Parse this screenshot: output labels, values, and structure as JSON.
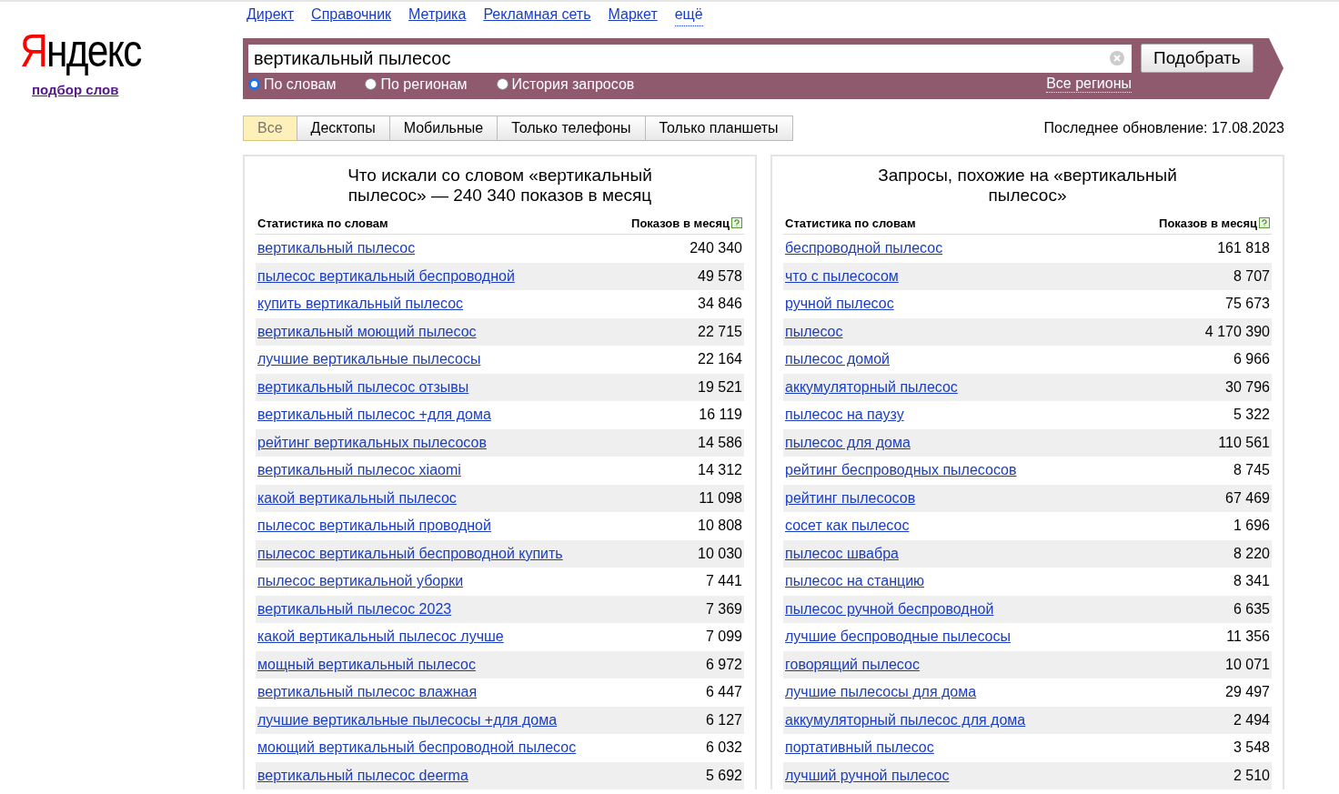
{
  "nav_links": [
    {
      "label": "Директ",
      "kind": "link"
    },
    {
      "label": "Справочник",
      "kind": "link"
    },
    {
      "label": "Метрика",
      "kind": "link"
    },
    {
      "label": "Рекламная сеть",
      "kind": "link"
    },
    {
      "label": "Маркет",
      "kind": "link"
    },
    {
      "label": "ещё",
      "kind": "more"
    }
  ],
  "logo": {
    "initial": "Я",
    "rest": "ндекс",
    "subtitle": "подбор слов"
  },
  "search": {
    "value": "вертикальный пылесос",
    "button": "Подобрать",
    "modes": [
      {
        "label": "По словам",
        "selected": true
      },
      {
        "label": "По регионам",
        "selected": false
      },
      {
        "label": "История запросов",
        "selected": false
      }
    ],
    "region_link": "Все регионы"
  },
  "device_tabs": [
    {
      "label": "Все",
      "selected": true
    },
    {
      "label": "Десктопы",
      "selected": false
    },
    {
      "label": "Мобильные",
      "selected": false
    },
    {
      "label": "Только телефоны",
      "selected": false
    },
    {
      "label": "Только планшеты",
      "selected": false
    }
  ],
  "last_update": "Последнее обновление: 17.08.2023",
  "panels": [
    {
      "title": "Что искали со словом «вертикальный пылесос» — 240 340 показов в месяц",
      "columns": [
        "Статистика по словам",
        "Показов в месяц"
      ],
      "rows": [
        {
          "phrase": "вертикальный пылесос",
          "count": "240 340"
        },
        {
          "phrase": "пылесос вертикальный беспроводной",
          "count": "49 578"
        },
        {
          "phrase": "купить вертикальный пылесос",
          "count": "34 846"
        },
        {
          "phrase": "вертикальный моющий пылесос",
          "count": "22 715"
        },
        {
          "phrase": "лучшие вертикальные пылесосы",
          "count": "22 164"
        },
        {
          "phrase": "вертикальный пылесос отзывы",
          "count": "19 521"
        },
        {
          "phrase": "вертикальный пылесос +для дома",
          "count": "16 119"
        },
        {
          "phrase": "рейтинг вертикальных пылесосов",
          "count": "14 586"
        },
        {
          "phrase": "вертикальный пылесос xiaomi",
          "count": "14 312"
        },
        {
          "phrase": "какой вертикальный пылесос",
          "count": "11 098"
        },
        {
          "phrase": "пылесос вертикальный проводной",
          "count": "10 808"
        },
        {
          "phrase": "пылесос вертикальный беспроводной купить",
          "count": "10 030"
        },
        {
          "phrase": "пылесос вертикальной уборки",
          "count": "7 441"
        },
        {
          "phrase": "вертикальный пылесос 2023",
          "count": "7 369"
        },
        {
          "phrase": "какой вертикальный пылесос лучше",
          "count": "7 099"
        },
        {
          "phrase": "мощный вертикальный пылесос",
          "count": "6 972"
        },
        {
          "phrase": "вертикальный пылесос влажная",
          "count": "6 447"
        },
        {
          "phrase": "лучшие вертикальные пылесосы +для дома",
          "count": "6 127"
        },
        {
          "phrase": "моющий вертикальный беспроводной пылесос",
          "count": "6 032"
        },
        {
          "phrase": "вертикальный пылесос deerma",
          "count": "5 692"
        }
      ]
    },
    {
      "title": "Запросы, похожие на «вертикальный пылесос»",
      "columns": [
        "Статистика по словам",
        "Показов в месяц"
      ],
      "rows": [
        {
          "phrase": "беспроводной пылесос",
          "count": "161 818"
        },
        {
          "phrase": "что с пылесосом",
          "count": "8 707"
        },
        {
          "phrase": "ручной пылесос",
          "count": "75 673"
        },
        {
          "phrase": "пылесос",
          "count": "4 170 390"
        },
        {
          "phrase": "пылесос домой",
          "count": "6 966"
        },
        {
          "phrase": "аккумуляторный пылесос",
          "count": "30 796"
        },
        {
          "phrase": "пылесос на паузу",
          "count": "5 322"
        },
        {
          "phrase": "пылесос для дома",
          "count": "110 561"
        },
        {
          "phrase": "рейтинг беспроводных пылесосов",
          "count": "8 745"
        },
        {
          "phrase": "рейтинг пылесосов",
          "count": "67 469"
        },
        {
          "phrase": "сосет как пылесос",
          "count": "1 696"
        },
        {
          "phrase": "пылесос швабра",
          "count": "8 220"
        },
        {
          "phrase": "пылесос на станцию",
          "count": "8 341"
        },
        {
          "phrase": "пылесос ручной беспроводной",
          "count": "6 635"
        },
        {
          "phrase": "лучшие беспроводные пылесосы",
          "count": "11 356"
        },
        {
          "phrase": "говорящий пылесос",
          "count": "10 071"
        },
        {
          "phrase": "лучшие пылесосы для дома",
          "count": "29 497"
        },
        {
          "phrase": "аккумуляторный пылесос для дома",
          "count": "2 494"
        },
        {
          "phrase": "портативный пылесос",
          "count": "3 548"
        },
        {
          "phrase": "лучший ручной пылесос",
          "count": "2 510"
        }
      ]
    }
  ]
}
